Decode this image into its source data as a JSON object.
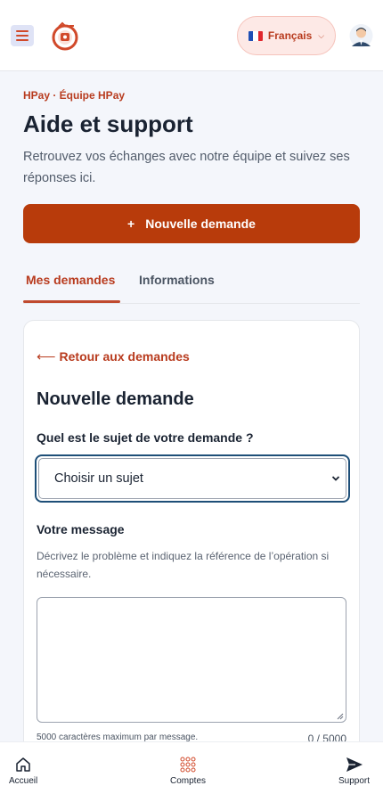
{
  "header": {
    "language": {
      "label": "Français",
      "flag_colors": [
        "#1f4fb5",
        "#ffffff",
        "#e1262d"
      ]
    },
    "icons": {
      "menu": "hamburger-menu-icon",
      "logo": "hpay-logo-icon",
      "avatar": "user-avatar-icon"
    },
    "brand_color": "#b83b1e"
  },
  "page": {
    "eyebrow": "HPay · Équipe HPay",
    "title": "Aide et support",
    "subtitle": "Retrouvez vos échanges avec notre équipe et suivez ses réponses ici.",
    "new_request_button": "Nouvelle demande",
    "new_request_icon": "+"
  },
  "tabs": [
    {
      "label": "Mes demandes",
      "active": true
    },
    {
      "label": "Informations",
      "active": false
    }
  ],
  "form": {
    "back_link": "Retour aux demandes",
    "back_icon": "⟵",
    "title": "Nouvelle demande",
    "subject_label": "Quel est le sujet de votre demande ?",
    "subject_value": "Choisir un sujet",
    "message_label": "Votre message",
    "message_help": "Décrivez le problème et indiquez la référence de l’opération si nécessaire.",
    "message_value": "",
    "limit_note": "5000 caractères maximum par message.",
    "counter": "0 / 5000",
    "focus_color": "#1e4f78"
  },
  "bottom_nav": [
    {
      "label": "Accueil",
      "icon": "home-icon"
    },
    {
      "label": "Comptes",
      "icon": "accounts-grid-icon"
    },
    {
      "label": "Support",
      "icon": "send-icon"
    }
  ]
}
